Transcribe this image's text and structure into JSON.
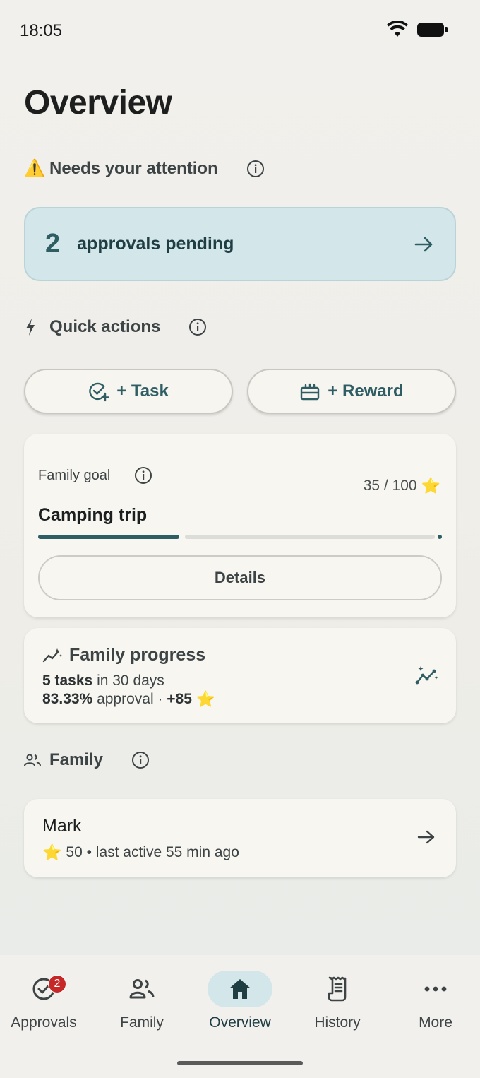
{
  "status_bar": {
    "time": "18:05"
  },
  "page_title": "Overview",
  "attention": {
    "icon": "⚠️",
    "title": "Needs your attention",
    "approvals_count": "2",
    "approvals_label": "approvals pending"
  },
  "quick_actions": {
    "title": "Quick actions",
    "task_label": "+ Task",
    "reward_label": "+ Reward"
  },
  "family_goal": {
    "label": "Family goal",
    "score": "35 / 100",
    "score_icon": "⭐",
    "name": "Camping trip",
    "progress_fraction": 0.35,
    "details_label": "Details"
  },
  "family_progress": {
    "title": "Family progress",
    "tasks_strong": "5 tasks",
    "tasks_rest": " in 30 days",
    "approval_strong": "83.33%",
    "approval_rest": " approval · ",
    "points": "+85",
    "points_icon": "⭐"
  },
  "family": {
    "title": "Family",
    "members": [
      {
        "name": "Mark",
        "star": "⭐",
        "meta": "50 • last active 55 min ago"
      }
    ]
  },
  "nav": {
    "items": [
      {
        "label": "Approvals",
        "badge": "2"
      },
      {
        "label": "Family"
      },
      {
        "label": "Overview"
      },
      {
        "label": "History"
      },
      {
        "label": "More"
      }
    ],
    "active": "Overview"
  },
  "colors": {
    "accent": "#2f5d64",
    "approvals_bg": "#d3e6ea",
    "badge": "#c62828",
    "star": "#f6c12b"
  }
}
